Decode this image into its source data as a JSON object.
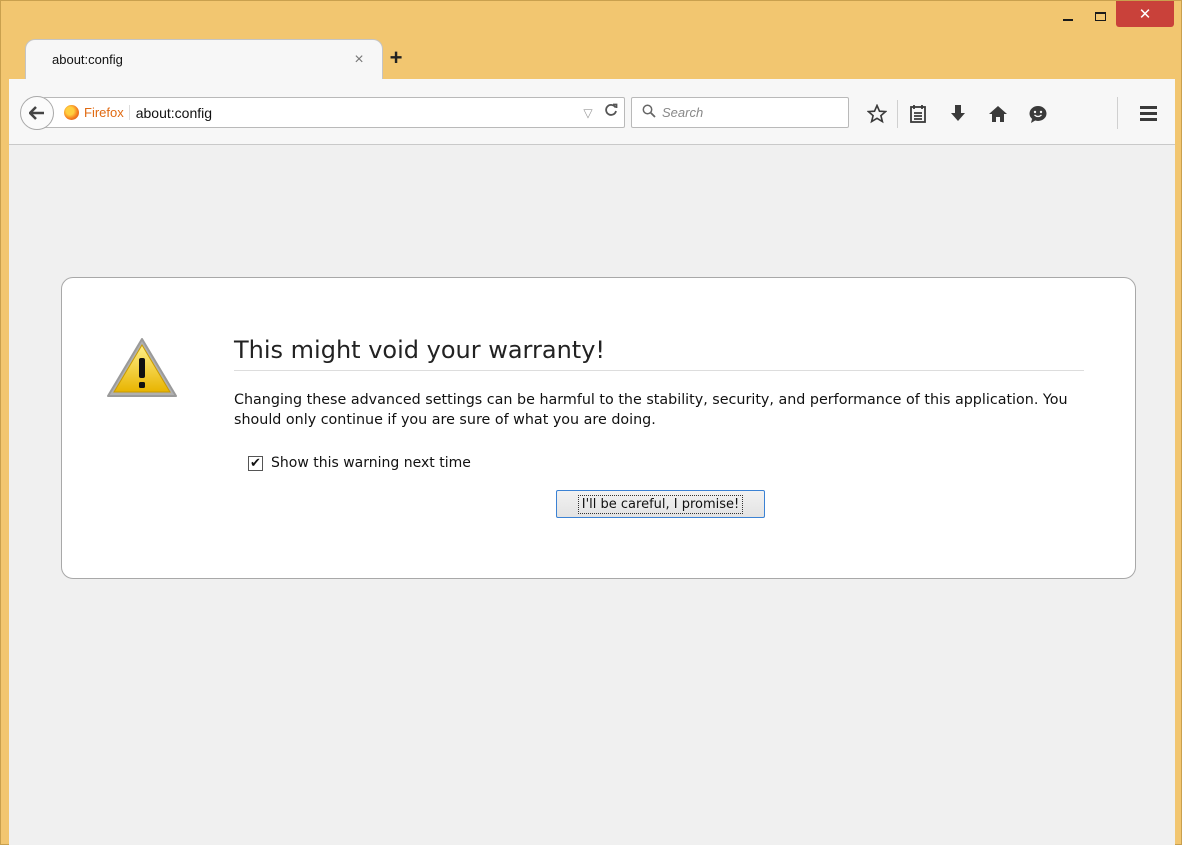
{
  "window": {
    "minimize_glyph": "",
    "close_glyph": "✕"
  },
  "tab": {
    "title": "about:config",
    "close_glyph": "×",
    "new_tab_glyph": "+"
  },
  "toolbar": {
    "back_glyph": "🡐",
    "identity_label": "Firefox",
    "url": "about:config",
    "dropdown_glyph": "▽",
    "reload_glyph": "C",
    "search_placeholder": "Search",
    "icons": [
      {
        "name": "bookmark-star-icon",
        "glyph": "☆"
      },
      {
        "name": "bookmarks-menu-icon",
        "glyph": "⊟"
      },
      {
        "name": "downloads-icon",
        "glyph": "⬇"
      },
      {
        "name": "home-icon",
        "glyph": "⌂"
      },
      {
        "name": "hello-icon",
        "glyph": "●"
      }
    ]
  },
  "warning": {
    "title": "This might void your warranty!",
    "text": "Changing these advanced settings can be harmful to the stability, security, and performance of this application. You should only continue if you are sure of what you are doing.",
    "checkbox_label": "Show this warning next time",
    "checkbox_checked": true,
    "checkbox_glyph": "✔",
    "button_label": "I'll be careful, I promise!"
  },
  "colors": {
    "frame": "#f2c670",
    "close_button": "#c9413a",
    "accent": "#3b82d4",
    "identity": "#e06a12"
  }
}
